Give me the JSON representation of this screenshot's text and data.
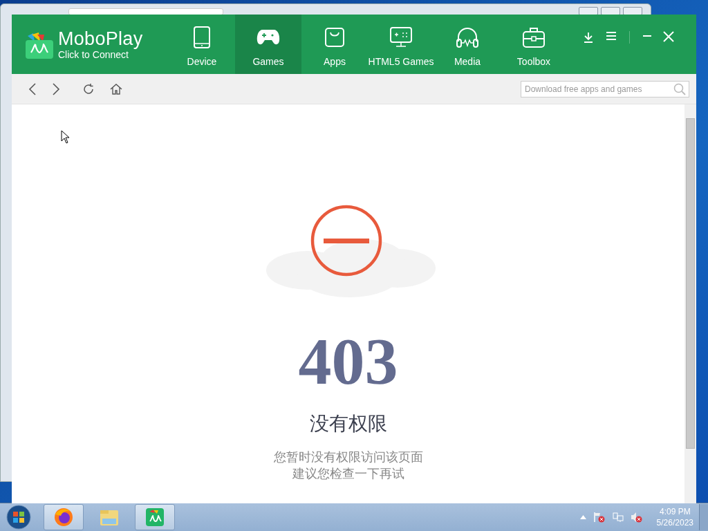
{
  "app": {
    "title": "MoboPlay",
    "subtitle": "Click to Connect"
  },
  "tabs": [
    {
      "label": "Device",
      "kind": "device",
      "selected": false
    },
    {
      "label": "Games",
      "kind": "gamepad",
      "selected": true
    },
    {
      "label": "Apps",
      "kind": "bag",
      "selected": false
    },
    {
      "label": "HTML5 Games",
      "kind": "monitor",
      "selected": false
    },
    {
      "label": "Media",
      "kind": "headphones",
      "selected": false
    },
    {
      "label": "Toolbox",
      "kind": "toolbox",
      "selected": false
    }
  ],
  "search": {
    "placeholder": "Download free apps and games"
  },
  "error": {
    "code": "403",
    "title": "没有权限",
    "lines": [
      "您暂时没有权限访问该页面",
      "建议您检查一下再试"
    ]
  },
  "taskbar": {
    "apps": [
      {
        "kind": "firefox",
        "open": true
      },
      {
        "kind": "explorer",
        "open": false
      },
      {
        "kind": "moboplay",
        "open": true
      }
    ],
    "time": "4:09 PM",
    "date": "5/26/2023"
  }
}
